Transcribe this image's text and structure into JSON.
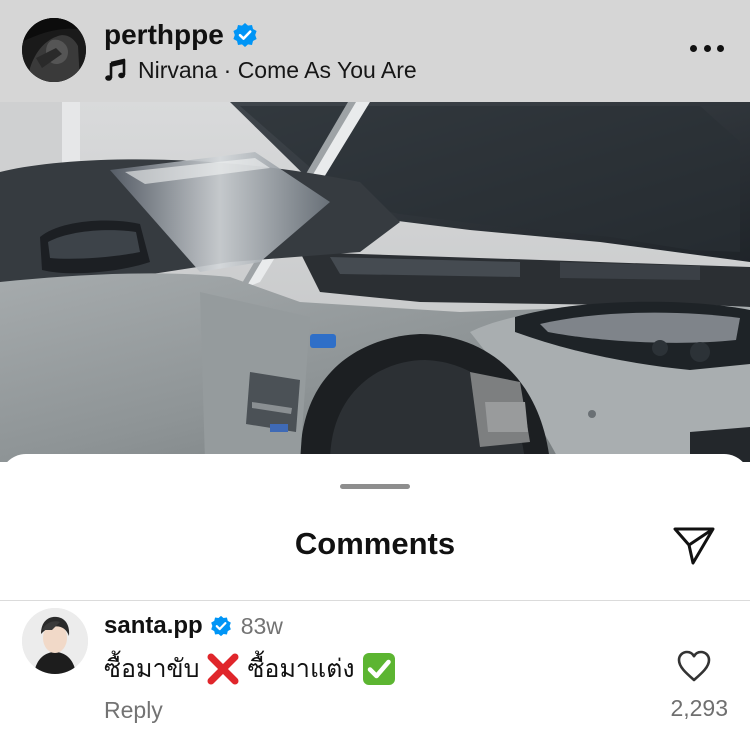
{
  "post": {
    "username": "perthppe",
    "verified": true,
    "music": "Nirvana · Come As You Are",
    "icons": [
      "music-note-icon",
      "verified-badge-icon",
      "more-options-icon"
    ]
  },
  "photo": {
    "subject": "Grey car with open hood"
  },
  "comments_sheet": {
    "title": "Comments",
    "share_icon": "paper-plane-icon",
    "items": [
      {
        "username": "santa.pp",
        "verified": true,
        "time": "83w",
        "text_part1": "ซื้อมาขับ",
        "text_part2": "ซื้อมาแต่ง",
        "reply_label": "Reply",
        "like_count": "2,293"
      }
    ]
  },
  "colors": {
    "verified_blue": "#0095f6",
    "header_bg": "#d6d6d6",
    "secondary_text": "#737373",
    "cross_red": "#e0262b",
    "check_green": "#5cb531"
  }
}
